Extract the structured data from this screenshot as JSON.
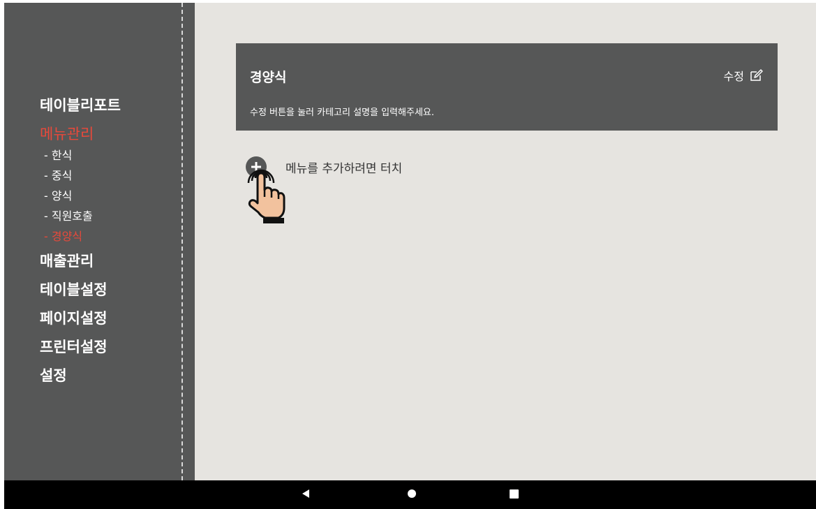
{
  "sidebar": {
    "menu": [
      {
        "label": "테이블리포트"
      },
      {
        "label": "메뉴관리"
      },
      {
        "label": "매출관리"
      },
      {
        "label": "테이블설정"
      },
      {
        "label": "페이지설정"
      },
      {
        "label": "프린터설정"
      },
      {
        "label": "설정"
      }
    ],
    "submenu": [
      {
        "label": "- 한식"
      },
      {
        "label": "- 중식"
      },
      {
        "label": "- 양식"
      },
      {
        "label": "- 직원호출"
      },
      {
        "label": "- 경양식"
      }
    ]
  },
  "category": {
    "title": "경양식",
    "description": "수정 버튼을 눌러 카테고리 설명을 입력해주세요.",
    "edit_label": "수정"
  },
  "add_menu": {
    "label": "메뉴를 추가하려면 터치"
  },
  "colors": {
    "sidebar_bg": "#565757",
    "accent_red": "#e8493b",
    "content_bg": "#e6e4e0"
  },
  "icons": [
    "edit-icon",
    "add-icon",
    "tap-hand-icon",
    "back-icon",
    "home-icon",
    "recents-icon"
  ]
}
